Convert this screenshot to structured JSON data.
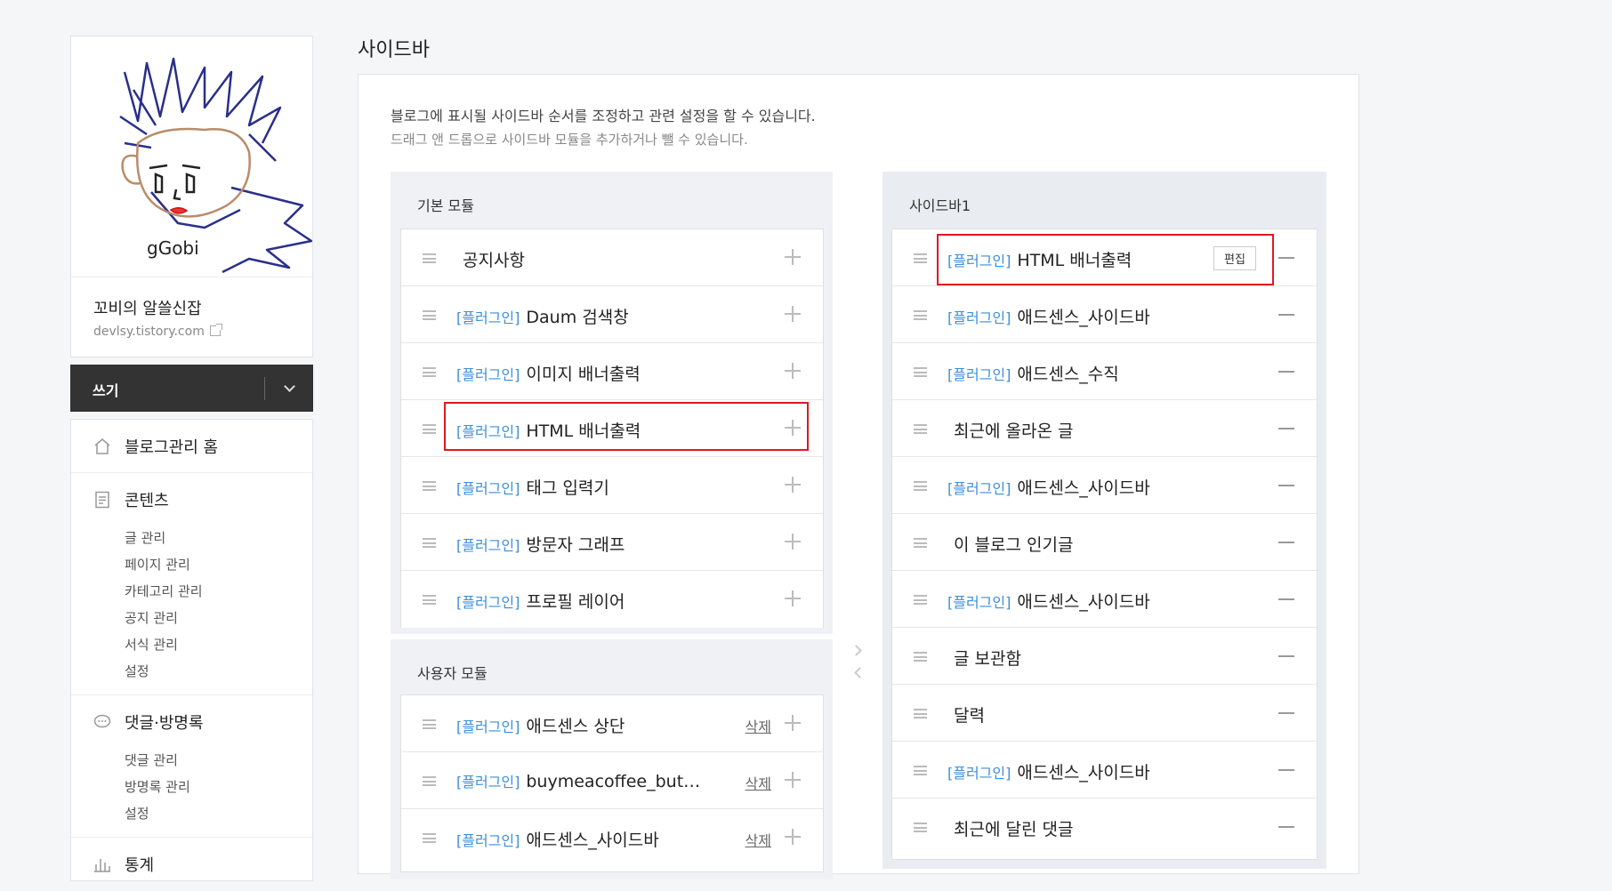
{
  "profile": {
    "blog_name": "꼬비의 알쓸신잡",
    "blog_url": "devlsy.tistory.com",
    "avatar_signature": "gGobi"
  },
  "write_button": {
    "label": "쓰기"
  },
  "menu": {
    "home": "블로그관리 홈",
    "contents": {
      "title": "콘텐츠",
      "items": [
        "글 관리",
        "페이지 관리",
        "카테고리 관리",
        "공지 관리",
        "서식 관리",
        "설정"
      ]
    },
    "comments": {
      "title": "댓글·방명록",
      "items": [
        "댓글 관리",
        "방명록 관리",
        "설정"
      ]
    },
    "stats": {
      "title": "통계"
    }
  },
  "page": {
    "title": "사이드바",
    "desc1": "블로그에 표시될 사이드바 순서를 조정하고 관련 설정을 할 수 있습니다.",
    "desc2": "드래그 앤 드롭으로 사이드바 모듈을 추가하거나 뺄 수 있습니다."
  },
  "basic_modules": {
    "title": "기본 모듈",
    "items": [
      {
        "tag": "",
        "name": "공지사항"
      },
      {
        "tag": "[플러그인]",
        "name": "Daum 검색창"
      },
      {
        "tag": "[플러그인]",
        "name": "이미지 배너출력"
      },
      {
        "tag": "[플러그인]",
        "name": "HTML 배너출력"
      },
      {
        "tag": "[플러그인]",
        "name": "태그 입력기"
      },
      {
        "tag": "[플러그인]",
        "name": "방문자 그래프"
      },
      {
        "tag": "[플러그인]",
        "name": "프로필 레이어"
      }
    ]
  },
  "user_modules": {
    "title": "사용자 모듈",
    "delete_label": "삭제",
    "items": [
      {
        "tag": "[플러그인]",
        "name": "애드센스 상단"
      },
      {
        "tag": "[플러그인]",
        "name": "buymeacoffee_but…"
      },
      {
        "tag": "[플러그인]",
        "name": "애드센스_사이드바"
      }
    ]
  },
  "sidebar1": {
    "title": "사이드바1",
    "edit_label": "편집",
    "items": [
      {
        "tag": "[플러그인]",
        "name": "HTML 배너출력"
      },
      {
        "tag": "[플러그인]",
        "name": "애드센스_사이드바"
      },
      {
        "tag": "[플러그인]",
        "name": "애드센스_수직"
      },
      {
        "tag": "",
        "name": "최근에 올라온 글"
      },
      {
        "tag": "[플러그인]",
        "name": "애드센스_사이드바"
      },
      {
        "tag": "",
        "name": "이 블로그 인기글"
      },
      {
        "tag": "[플러그인]",
        "name": "애드센스_사이드바"
      },
      {
        "tag": "",
        "name": "글 보관함"
      },
      {
        "tag": "",
        "name": "달력"
      },
      {
        "tag": "[플러그인]",
        "name": "애드센스_사이드바"
      },
      {
        "tag": "",
        "name": "최근에 달린 댓글"
      }
    ]
  },
  "colors": {
    "plugin_tag": "#3d8ed9",
    "highlight": "#e0171f",
    "write_bar": "#333333"
  }
}
